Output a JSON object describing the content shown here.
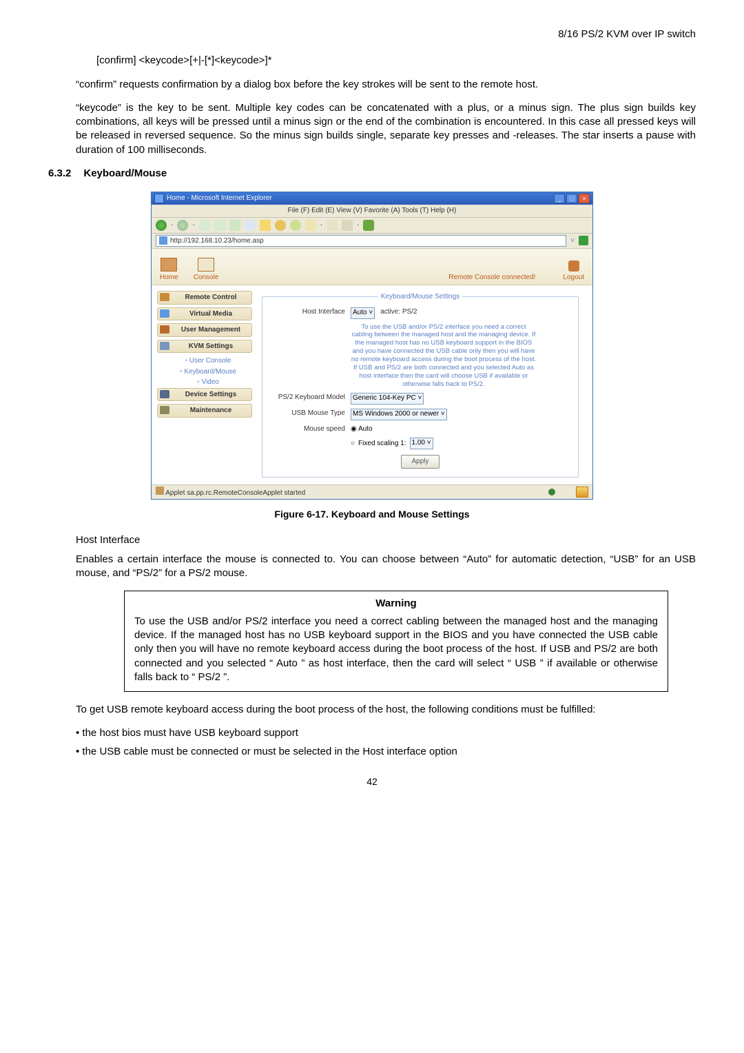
{
  "header": {
    "title": "8/16 PS/2 KVM over IP switch"
  },
  "code_sample": "[confirm] <keycode>[+|-[*]<keycode>]*",
  "para1": "“confirm” requests confirmation by a dialog box before the key strokes will be sent to the remote host.",
  "para2": "“keycode” is the key to be sent. Multiple key codes can be concatenated with a plus, or a minus sign. The plus sign builds key combinations, all keys will be pressed until a minus sign or the end of the combination is encountered. In this case all pressed keys will be released in reversed sequence. So the minus sign builds single, separate key presses and -releases. The star inserts a pause with duration of 100 milliseconds.",
  "section": {
    "num": "6.3.2",
    "title": "Keyboard/Mouse"
  },
  "ie": {
    "title": "Home - Microsoft Internet Explorer",
    "menu": "File (F)  Edit (E)  View (V)  Favorite (A)  Tools (T)  Help (H)",
    "address": "http://192.168.10.23/home.asp",
    "status": "Applet sa.pp.rc.RemoteConsoleApplet started"
  },
  "app": {
    "top": {
      "home": "Home",
      "console": "Console",
      "status": "Remote Console connected!",
      "logout": "Logout"
    },
    "side": {
      "remote_control": "Remote Control",
      "virtual_media": "Virtual Media",
      "user_management": "User Management",
      "kvm_settings": "KVM Settings",
      "kvm_sub1": "User Console",
      "kvm_sub2": "Keyboard/Mouse",
      "kvm_sub3": "Video",
      "device_settings": "Device Settings",
      "maintenance": "Maintenance"
    },
    "form": {
      "legend": "Keyboard/Mouse Settings",
      "host_interface_label": "Host Interface",
      "host_interface_value": "Auto",
      "host_interface_active": "active: PS/2",
      "hint": "To use the USB and/or PS/2 interface you need a correct cabling between the managed host and the managing device. If the managed host has no USB keyboard support in the BIOS and you have connected the USB cable only then you will have no remote keyboard access during the boot process of the host. If USB and PS/2 are both connected and you selected Auto as host interface then the card will choose USB if available or otherwise falls back to PS/2.",
      "kb_model_label": "PS/2 Keyboard Model",
      "kb_model_value": "Generic 104-Key PC",
      "mouse_type_label": "USB Mouse Type",
      "mouse_type_value": "MS Windows 2000 or newer",
      "mouse_speed_label": "Mouse speed",
      "mouse_speed_auto": "Auto",
      "mouse_speed_fixed": "Fixed scaling 1:",
      "mouse_speed_fixed_value": "1.00",
      "apply": "Apply"
    }
  },
  "figure_caption": "Figure 6-17. Keyboard and Mouse Settings",
  "host_interface_label": "Host Interface",
  "host_interface_para": "Enables a certain interface the mouse is connected to. You can choose between “Auto” for automatic detection, “USB” for an USB mouse, and “PS/2” for a PS/2 mouse.",
  "warning": {
    "title": "Warning",
    "body": "To use the USB and/or PS/2 interface you need a correct cabling between the managed host and the managing device. If the managed host has no USB keyboard support in the BIOS and you have connected the USB cable only then you will have no remote keyboard access during the boot process of the host. If USB and PS/2 are both connected and you selected “ Auto ” as host interface, then the card will select “ USB ” if available or otherwise falls back to “ PS/2 ”."
  },
  "after_warning": "To get USB remote keyboard access during the boot process of the host, the following conditions must be fulfilled:",
  "bullet1": "• the host bios must have USB keyboard support",
  "bullet2": "• the USB cable must be connected or must be selected in the Host interface option",
  "page_number": "42"
}
